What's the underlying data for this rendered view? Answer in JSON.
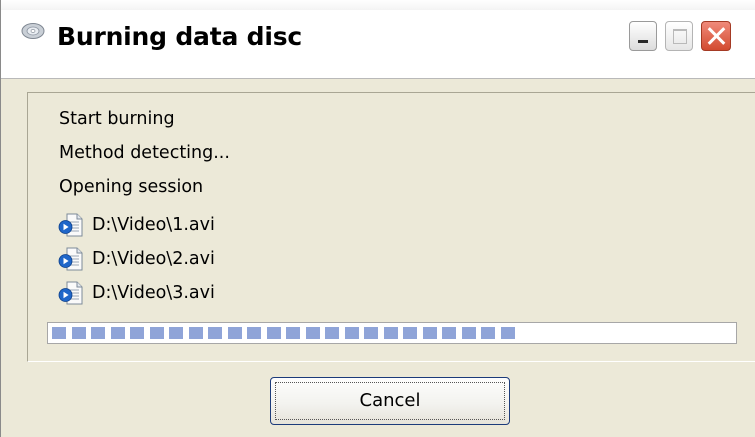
{
  "window": {
    "title": "Burning data disc",
    "icon": "disc-icon",
    "controls": [
      "minimize-icon",
      "maximize-icon",
      "close-icon"
    ]
  },
  "log": {
    "lines": [
      "Start burning",
      "Method detecting...",
      "Opening session"
    ],
    "files": [
      "D:\\Video\\1.avi",
      "D:\\Video\\2.avi",
      "D:\\Video\\3.avi"
    ],
    "file_icon": "media-file-icon"
  },
  "progress": {
    "fraction": 0.7
  },
  "buttons": {
    "cancel_label": "Cancel"
  },
  "colors": {
    "progress_chunk": "#8fa4d8",
    "close_button": "#d24b30"
  }
}
